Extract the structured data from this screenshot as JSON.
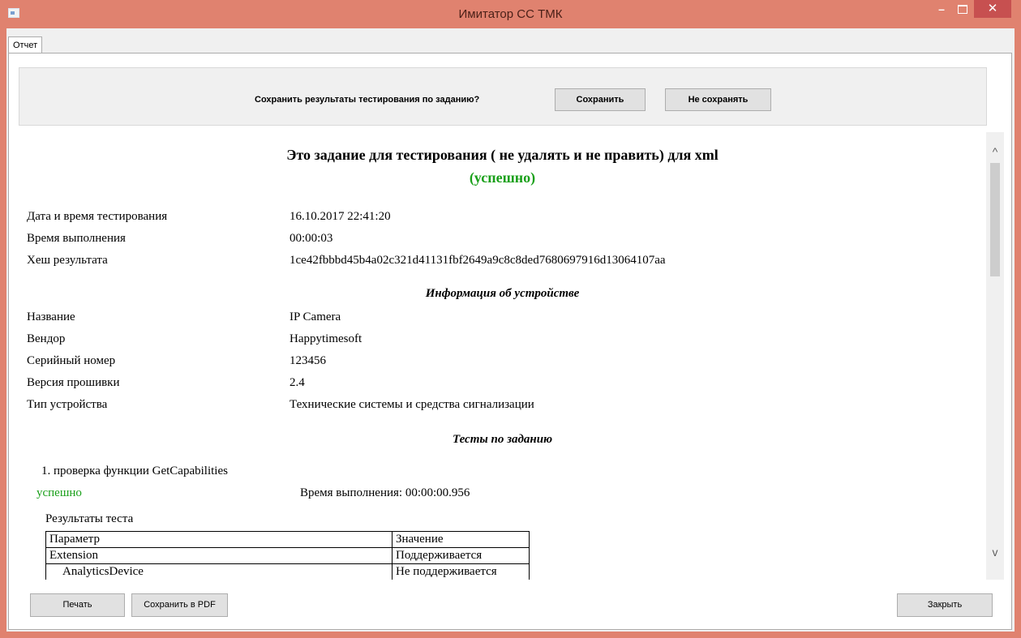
{
  "window": {
    "title": "Имитатор СС ТМК",
    "minimize_glyph": "–",
    "close_glyph": "✕"
  },
  "tabs": [
    {
      "label": "Отчет"
    }
  ],
  "save_prompt": {
    "question": "Сохранить результаты тестирования по заданию?",
    "save_label": "Сохранить",
    "dont_save_label": "Не сохранять"
  },
  "report": {
    "title": "Это задание для тестирования ( не удалять и не править) для xml",
    "status": "(успешно)",
    "status_color": "#1aa01a",
    "summary": [
      {
        "label": "Дата и время тестирования",
        "value": "16.10.2017 22:41:20"
      },
      {
        "label": "Время выполнения",
        "value": "00:00:03"
      },
      {
        "label": "Хеш результата",
        "value": "1ce42fbbbd45b4a02c321d41131fbf2649a9c8c8ded7680697916d13064107aa"
      }
    ],
    "device_section_title": "Информация об устройстве",
    "device": [
      {
        "label": "Название",
        "value": "IP Camera"
      },
      {
        "label": "Вендор",
        "value": "Happytimesoft"
      },
      {
        "label": "Серийный номер",
        "value": "123456"
      },
      {
        "label": "Версия прошивки",
        "value": "2.4"
      },
      {
        "label": "Тип устройства",
        "value": "Технические системы и средства сигнализации"
      }
    ],
    "tests_section_title": "Тесты по заданию",
    "tests": [
      {
        "name": "1. проверка функции GetCapabilities",
        "status": "успешно",
        "time": "Время выполнения: 00:00:00.956",
        "results_label": "Результаты теста",
        "table": {
          "headers": [
            "Параметр",
            "Значение"
          ],
          "rows": [
            [
              "Extension",
              "Поддерживается"
            ],
            [
              "AnalyticsDevice",
              "Не поддерживается"
            ]
          ]
        }
      }
    ]
  },
  "footer": {
    "print_label": "Печать",
    "save_pdf_label": "Сохранить в PDF",
    "close_label": "Закрыть"
  },
  "scrollbar": {
    "up_glyph": "^",
    "down_glyph": "v"
  }
}
